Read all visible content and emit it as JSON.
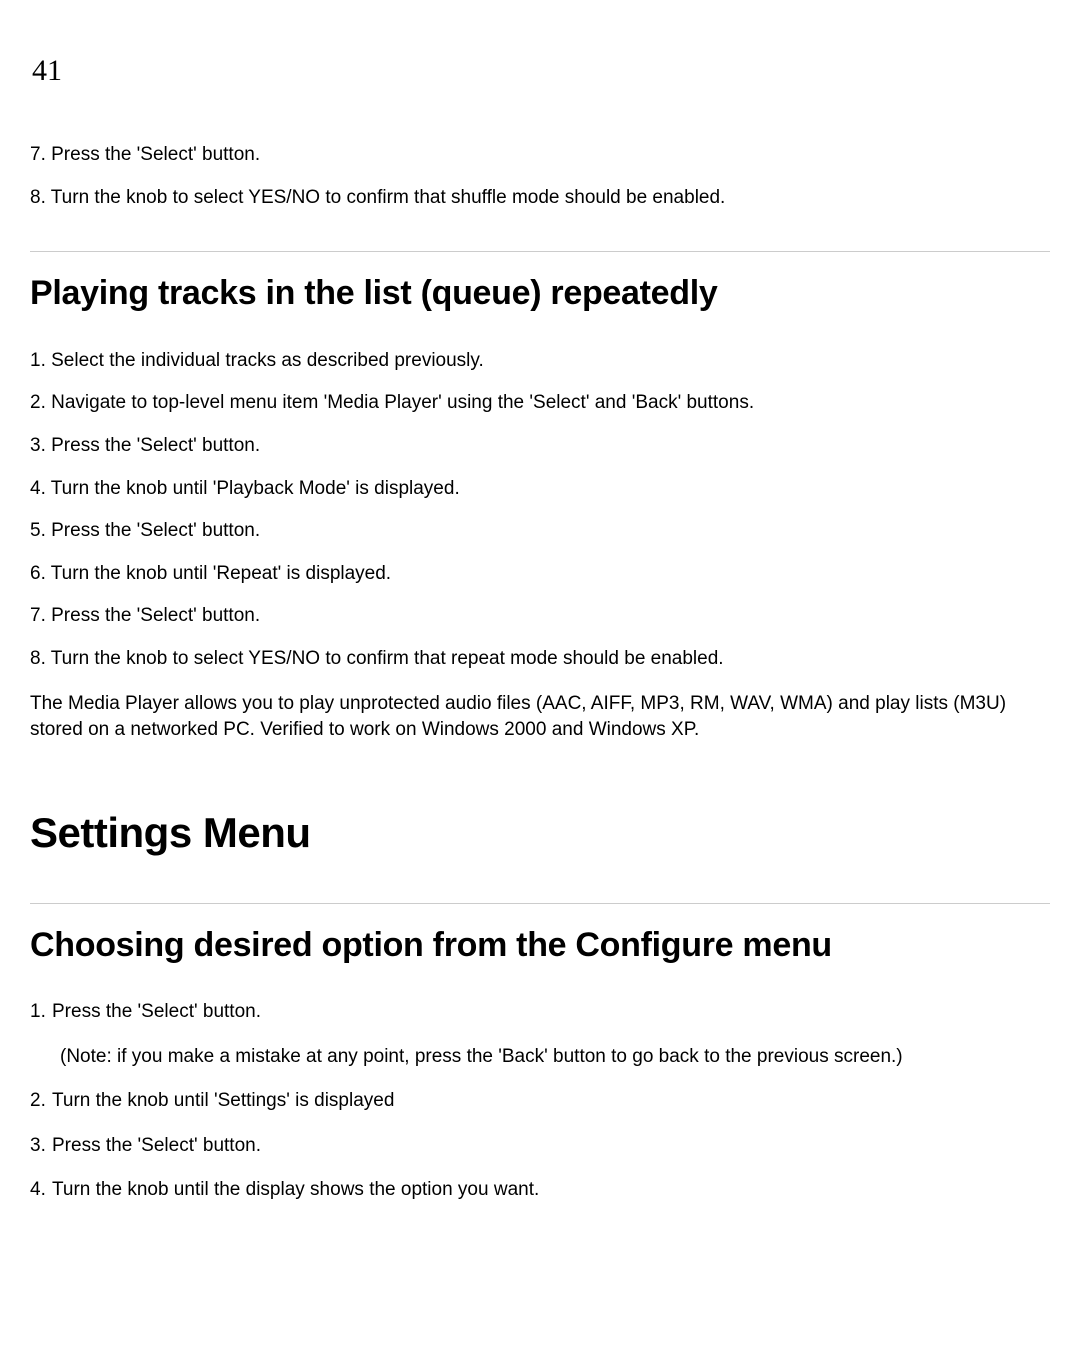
{
  "page_number": "41",
  "section1": {
    "step7": "7. Press the 'Select' button.",
    "step8": "8. Turn the knob to select YES/NO to confirm that shuffle mode should be enabled."
  },
  "section2": {
    "heading": "Playing tracks in the list (queue) repeatedly",
    "step1": "1. Select the individual tracks as described previously.",
    "step2": "2. Navigate to top-level menu item 'Media Player' using the 'Select' and 'Back' buttons.",
    "step3": "3. Press the 'Select' button.",
    "step4": "4. Turn the knob until 'Playback Mode' is displayed.",
    "step5": "5. Press the 'Select' button.",
    "step6": "6. Turn the knob until 'Repeat' is displayed.",
    "step7": "7. Press the 'Select' button.",
    "step8": "8. Turn the knob to select YES/NO to confirm that repeat mode should be enabled.",
    "paragraph": "The Media Player allows you to play unprotected audio files (AAC, AIFF, MP3, RM, WAV, WMA) and play lists (M3U) stored on a networked PC. Verified to work on Windows 2000 and Windows XP."
  },
  "section3": {
    "heading_main": "Settings Menu",
    "heading_sub": "Choosing desired option from the Configure menu",
    "step1_num": "1. ",
    "step1_text": "Press the 'Select' button.",
    "note": "(Note: if you make a mistake at any point, press the 'Back' button to go back to the previous screen.)",
    "step2_num": "2. ",
    "step2_text": "Turn the knob until 'Settings' is displayed",
    "step3_num": "3. ",
    "step3_text": "Press the 'Select' button.",
    "step4_num": "4. ",
    "step4_text": "Turn the knob until the display shows the option you want."
  }
}
